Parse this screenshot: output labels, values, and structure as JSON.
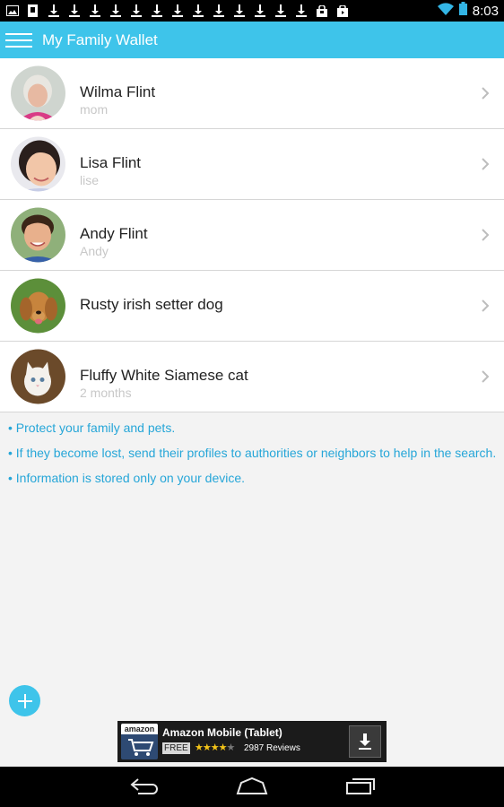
{
  "status_bar": {
    "time": "8:03",
    "notification_icons": [
      "image-icon",
      "sd-card-icon",
      "download-icon",
      "download-icon",
      "download-icon",
      "download-icon",
      "download-icon",
      "download-icon",
      "download-icon",
      "download-icon",
      "download-icon",
      "download-icon",
      "download-icon",
      "shopping-bag-icon",
      "play-store-icon"
    ],
    "system_icons": [
      "wifi-icon",
      "battery-icon"
    ]
  },
  "app_bar": {
    "title": "My Family Wallet",
    "menu_icon": "hamburger-menu-icon"
  },
  "members": [
    {
      "name": "Wilma  Flint",
      "subtitle": "mom",
      "avatar": "elderly-woman-photo"
    },
    {
      "name": "Lisa  Flint",
      "subtitle": "lise",
      "avatar": "girl-photo"
    },
    {
      "name": "Andy  Flint",
      "subtitle": "Andy",
      "avatar": "boy-photo"
    },
    {
      "name": "Rusty irish setter dog",
      "subtitle": "",
      "avatar": "dog-photo"
    },
    {
      "name": "Fluffy White Siamese cat",
      "subtitle": "2 months",
      "avatar": "cat-photo"
    }
  ],
  "info": {
    "lines": [
      "• Protect your family and pets.",
      "• If they become lost, send their profiles to authorities or neighbors to help in the search.",
      "• Information is stored only on your device."
    ]
  },
  "fab": {
    "icon": "plus-icon"
  },
  "ad": {
    "logo_text": "amazon",
    "title": "Amazon Mobile (Tablet)",
    "price": "FREE",
    "rating": 4,
    "reviews": "2987 Reviews",
    "stars_filled": "★★★★",
    "stars_empty": "★"
  },
  "nav_bar": {
    "buttons": [
      "back-icon",
      "home-icon",
      "recent-apps-icon"
    ]
  },
  "colors": {
    "accent": "#3ec4ea",
    "info_text": "#26a6d8",
    "subtitle": "#c8c8c8"
  }
}
